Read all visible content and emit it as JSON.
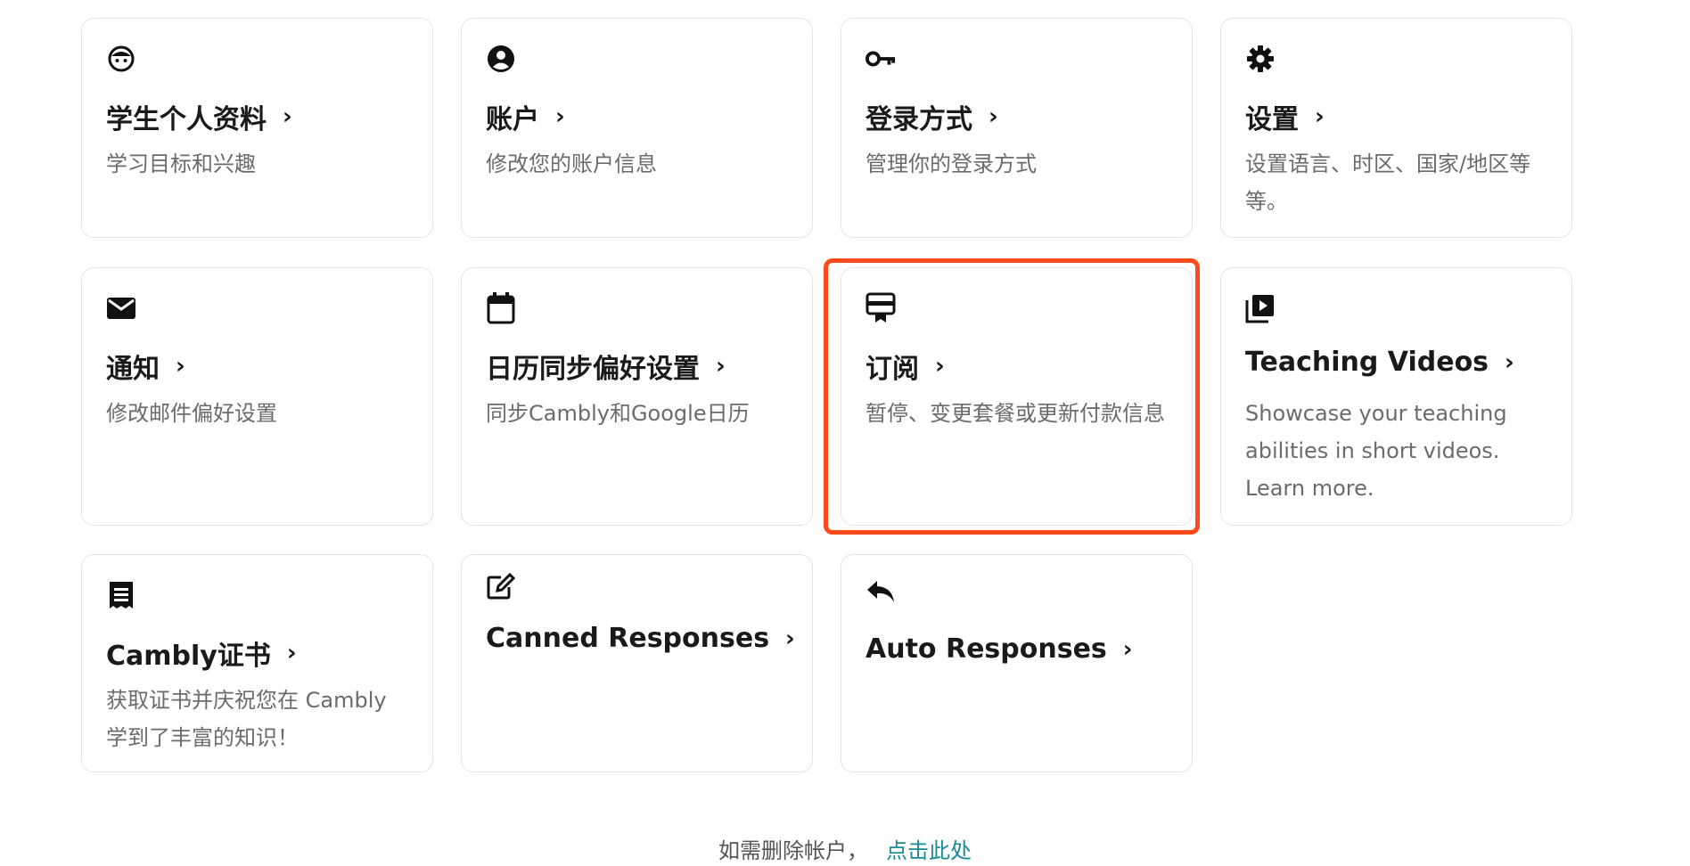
{
  "cards": [
    {
      "icon": "student-face-icon",
      "title": "学生个人资料",
      "desc": "学习目标和兴趣"
    },
    {
      "icon": "account-circle-icon",
      "title": "账户",
      "desc": "修改您的账户信息"
    },
    {
      "icon": "key-icon",
      "title": "登录方式",
      "desc": "管理你的登录方式"
    },
    {
      "icon": "gear-icon",
      "title": "设置",
      "desc": "设置语言、时区、国家/地区等等。"
    },
    {
      "icon": "envelope-icon",
      "title": "通知",
      "desc": "修改邮件偏好设置"
    },
    {
      "icon": "calendar-icon",
      "title": "日历同步偏好设置",
      "desc": "同步Cambly和Google日历"
    },
    {
      "icon": "subscription-card-icon",
      "title": "订阅",
      "desc": "暂停、变更套餐或更新付款信息"
    },
    {
      "icon": "video-library-icon",
      "title": "Teaching Videos",
      "desc": "Showcase your teaching abilities in short videos. Learn more."
    },
    {
      "icon": "certificate-icon",
      "title": "Cambly证书",
      "desc": "获取证书并庆祝您在 Cambly 学到了丰富的知识！"
    },
    {
      "icon": "edit-icon",
      "title": "Canned Responses",
      "desc": ""
    },
    {
      "icon": "reply-icon",
      "title": "Auto Responses",
      "desc": ""
    }
  ],
  "chevron": "›",
  "footer": {
    "text": "如需删除帐户，",
    "link": "点击此处"
  },
  "colors": {
    "highlight": "#ff4a1c",
    "link": "#1a8a94"
  }
}
